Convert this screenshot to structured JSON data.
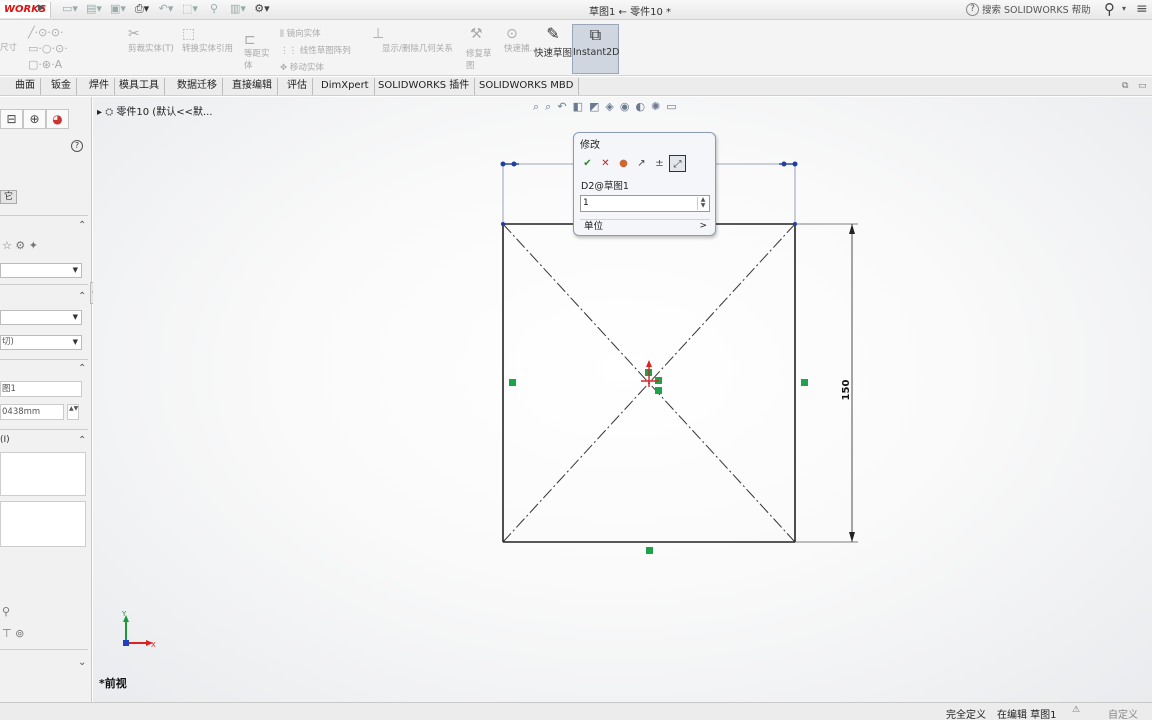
{
  "titlebar": {
    "logo": "WORKS",
    "title": "草图1 ← 零件10 *",
    "help_search": "搜索 SOLIDWORKS 帮助"
  },
  "ribbon": {
    "left_stub": "尺寸",
    "dim_labels": [
      "剪裁实体(T)",
      "转换实体引用",
      "等距实体",
      "镜向实体",
      "线性草图阵列",
      "移动实体",
      "显示/删除几何关系",
      "修复草图",
      "快速捕..."
    ],
    "quick_snap_label": "快速草图",
    "instant2d_label": "Instant2D"
  },
  "tabs": [
    "曲面",
    "钣金",
    "焊件",
    "模具工具",
    "数据迁移",
    "直接编辑",
    "评估",
    "DimXpert",
    "SOLIDWORKS 插件",
    "SOLIDWORKS MBD"
  ],
  "left_panel": {
    "tab_label": "它",
    "combo1": "",
    "combo2": "",
    "combo3": "切)",
    "field1": "图1",
    "field2": "0438mm",
    "section_label": "(I)"
  },
  "canvas": {
    "feature_tree_item": "零件10  (默认<<默...",
    "view_label": "*前视",
    "dimension_vertical": "150",
    "axis_x": "X",
    "axis_y": "Y"
  },
  "modify_dialog": {
    "title": "修改",
    "dim_name": "D2@草图1",
    "value": "1",
    "units_label": "单位",
    "units_arrow": ">"
  },
  "status": {
    "fully_defined": "完全定义",
    "editing": "在编辑 草图1",
    "custom": "自定义"
  }
}
